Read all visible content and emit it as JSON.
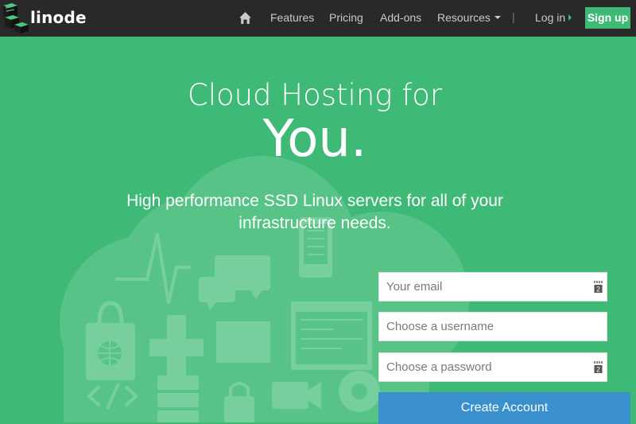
{
  "nav": {
    "brand": "linode",
    "home_icon": "home-icon",
    "links": [
      "Features",
      "Pricing",
      "Add-ons",
      "Resources"
    ],
    "separator": "|",
    "login": "Log in",
    "signup": "Sign up"
  },
  "hero": {
    "line1": "Cloud Hosting for",
    "line2": "You.",
    "subtitle": "High performance SSD Linux servers for all of your infrastructure needs."
  },
  "form": {
    "email_placeholder": "Your email",
    "username_placeholder": "Choose a username",
    "password_placeholder": "Choose a password",
    "submit_label": "Create Account"
  },
  "colors": {
    "accent": "#3fb976",
    "navbar": "#292929",
    "button": "#3a8fcd"
  },
  "icons": [
    "home-icon",
    "linode-logo-icon",
    "password-manager-icon",
    "cloud-illustration"
  ]
}
